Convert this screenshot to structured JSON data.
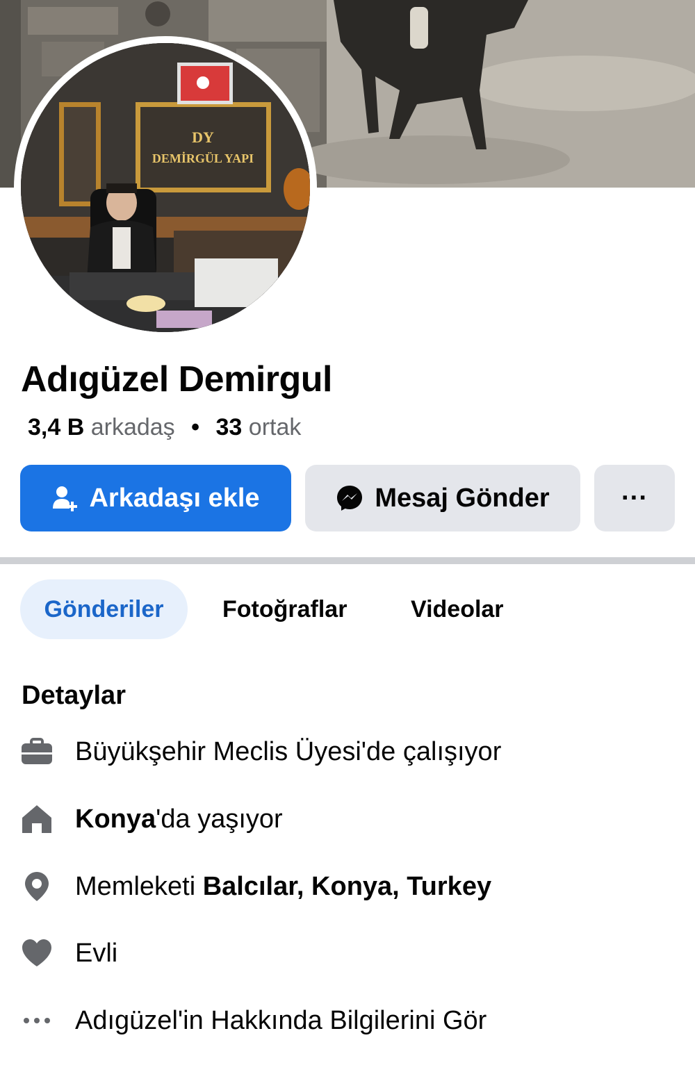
{
  "profile": {
    "name": "Adıgüzel Demirgul",
    "friends_count": "3,4 B",
    "friends_label": "arkadaş",
    "separator": "•",
    "mutual_count": "33",
    "mutual_label": "ortak"
  },
  "avatar": {
    "sign_text": "DEMİRGÜL YAPI",
    "logo_text": "DY"
  },
  "actions": {
    "add_friend": "Arkadaşı ekle",
    "message": "Mesaj Gönder",
    "more": "···"
  },
  "tabs": [
    {
      "label": "Gönderiler",
      "active": true
    },
    {
      "label": "Fotoğraflar",
      "active": false
    },
    {
      "label": "Videolar",
      "active": false
    }
  ],
  "details": {
    "title": "Detaylar",
    "work": "Büyükşehir Meclis Üyesi'de çalışıyor",
    "lives_bold": "Konya",
    "lives_rest": "'da yaşıyor",
    "from_prefix": "Memleketi ",
    "from_bold": "Balcılar, Konya, Turkey",
    "relationship": "Evli",
    "about_link": "Adıgüzel'in Hakkında Bilgilerini Gör"
  },
  "colors": {
    "primary_blue": "#1b74e4",
    "tab_active_text": "#1b66c9",
    "tab_active_bg": "#e7f0fc",
    "secondary_button": "#e4e6eb",
    "icon_gray": "#65676b"
  },
  "icons": [
    "add-friend-icon",
    "messenger-icon",
    "more-icon",
    "briefcase-icon",
    "home-icon",
    "location-pin-icon",
    "heart-icon",
    "ellipsis-icon"
  ]
}
